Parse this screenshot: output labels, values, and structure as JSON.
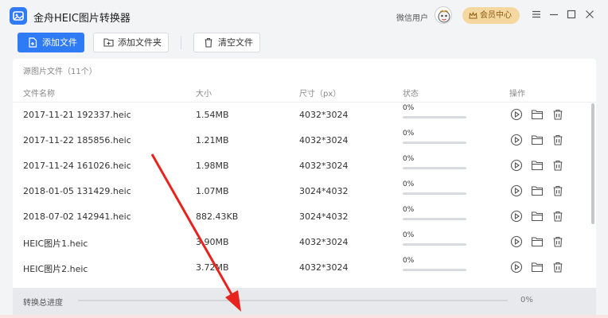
{
  "app": {
    "title": "金舟HEIC图片转换器",
    "user_name": "微信用户",
    "vip_label": "会员中心"
  },
  "toolbar": {
    "add_file": "添加文件",
    "add_folder": "添加文件夹",
    "clear_files": "清空文件"
  },
  "list": {
    "title": "源图片文件（11个）",
    "columns": {
      "name": "文件名称",
      "size": "大小",
      "dims": "尺寸（px）",
      "status": "状态",
      "actions": "操作"
    },
    "rows": [
      {
        "name": "2017-11-21 192337.heic",
        "size": "1.54MB",
        "dims": "4032*3024",
        "status": "0%",
        "progress": 0
      },
      {
        "name": "2017-11-22 185856.heic",
        "size": "1.21MB",
        "dims": "4032*3024",
        "status": "0%",
        "progress": 0
      },
      {
        "name": "2017-11-24 161026.heic",
        "size": "1.98MB",
        "dims": "4032*3024",
        "status": "0%",
        "progress": 0
      },
      {
        "name": "2018-01-05 131429.heic",
        "size": "1.07MB",
        "dims": "3024*4032",
        "status": "0%",
        "progress": 0
      },
      {
        "name": "2018-07-02 142941.heic",
        "size": "882.43KB",
        "dims": "3024*4032",
        "status": "0%",
        "progress": 0
      },
      {
        "name": "HEIC图片1.heic",
        "size": "3.90MB",
        "dims": "4032*3024",
        "status": "0%",
        "progress": 0
      },
      {
        "name": "HEIC图片2.heic",
        "size": "3.72MB",
        "dims": "4032*3024",
        "status": "0%",
        "progress": 0
      }
    ]
  },
  "footer": {
    "label": "转换总进度",
    "percent": "0%",
    "progress": 0
  },
  "icons": {
    "row_actions": [
      "play-icon",
      "folder-icon",
      "trash-icon"
    ],
    "window_controls": [
      "menu-icon",
      "minimize-icon",
      "maximize-icon",
      "close-icon"
    ]
  },
  "colors": {
    "accent": "#2f7bf6",
    "vip": "#f5d7a0",
    "annotation_arrow": "#e8231d"
  }
}
